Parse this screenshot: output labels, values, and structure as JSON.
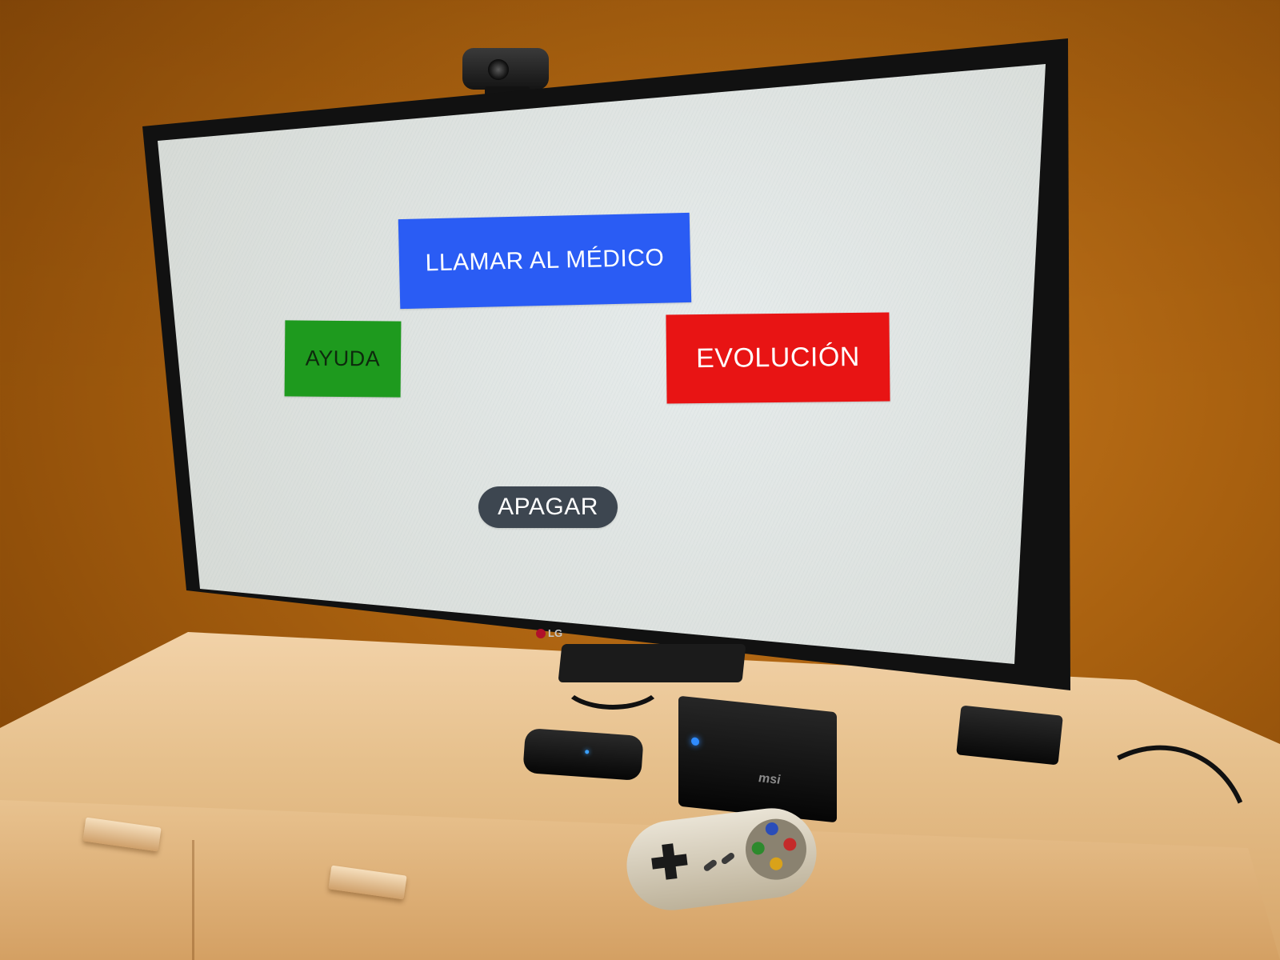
{
  "screen_ui": {
    "call_doctor_label": "LLAMAR AL MÉDICO",
    "help_label": "AYUDA",
    "evolution_label": "EVOLUCIÓN",
    "power_off_label": "APAGAR"
  },
  "tv": {
    "brand": "LG"
  },
  "devices": {
    "minipc_brand": "msi"
  },
  "colors": {
    "call_doctor": "#2a5cf4",
    "help": "#1e9a1e",
    "evolution": "#e81414",
    "power_off": "#3d4650",
    "screen_background": "#dde2e0"
  },
  "icons": {
    "power_led": "blue-status-led",
    "router_led": "blue-status-led"
  }
}
